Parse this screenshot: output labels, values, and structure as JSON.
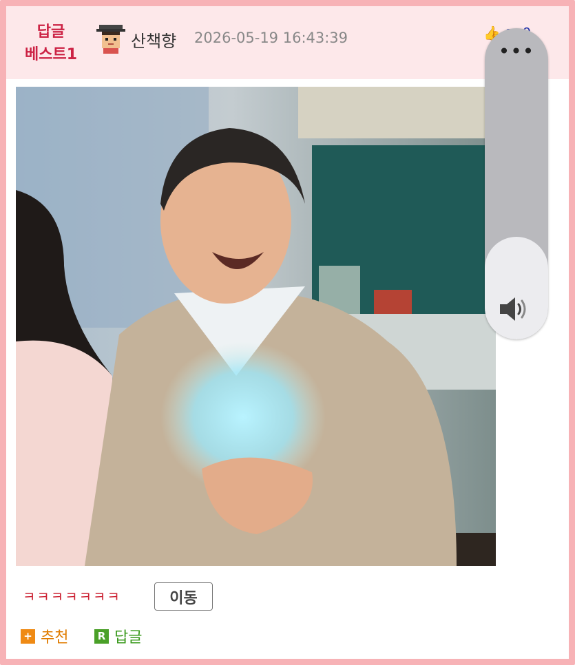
{
  "post": {
    "best_line1": "답글",
    "best_line2": "베스트1",
    "username": "산책향",
    "timestamp": "2026-05-19 16:43:39",
    "like_count": "0",
    "comment_text": "ㅋㅋㅋㅋㅋㅋㅋ",
    "move_label": "이동"
  },
  "actions": {
    "recommend_label": "추천",
    "recommend_badge": "+",
    "reply_label": "답글",
    "reply_badge": "R"
  },
  "volume": {
    "more_label": "•••",
    "level": 0.33
  },
  "icons": {
    "avatar": "avatar-pixel-icon",
    "like": "thumbs-up-icon",
    "comment": "comment-icon",
    "volume": "speaker-icon"
  },
  "colors": {
    "frame": "#f7b2b6",
    "header_bg": "#fde8ea",
    "best_text": "#cc2244",
    "recommend": "#ef8a14",
    "reply": "#4aa028",
    "volume_panel": "#b9b9bd"
  }
}
